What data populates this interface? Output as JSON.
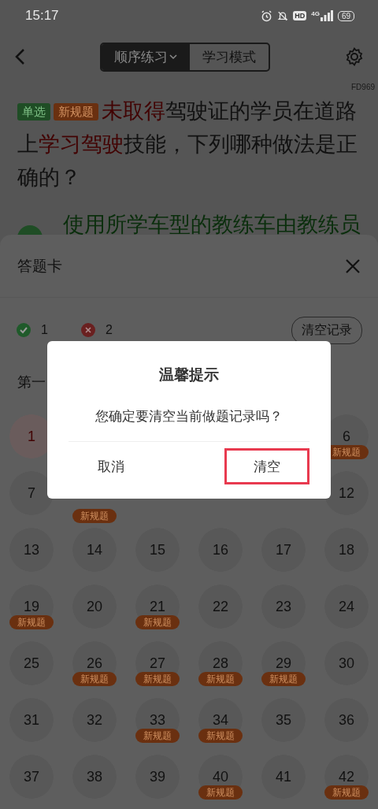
{
  "status_bar": {
    "time": "15:17",
    "hd": "HD",
    "network": "4G",
    "battery": "69"
  },
  "header": {
    "modes": [
      {
        "label": "顺序练习",
        "selected": true,
        "dropdown": true
      },
      {
        "label": "学习模式",
        "selected": false,
        "dropdown": false
      }
    ],
    "code": "FD969"
  },
  "question": {
    "tags": [
      {
        "label": "单选",
        "kind": "type"
      },
      {
        "label": "新规题",
        "kind": "new"
      }
    ],
    "segments": [
      {
        "text": "未取得",
        "highlight": true
      },
      {
        "text": "驾驶证的学员在道路上",
        "highlight": false
      },
      {
        "text": "学习驾驶",
        "highlight": true
      },
      {
        "text": "技能，下列哪种做法是正确的？",
        "highlight": false
      }
    ],
    "option": {
      "text": "使用所学车型的教练车由教练员"
    }
  },
  "answer_card": {
    "title": "答题卡",
    "correct": "1",
    "wrong": "2",
    "clear_button": "清空记录",
    "section": "第一",
    "cells": [
      {
        "kind": "number",
        "number": "1",
        "wrong": true
      },
      {
        "kind": "covered"
      },
      {
        "kind": "covered"
      },
      {
        "kind": "covered"
      },
      {
        "kind": "covered"
      },
      {
        "kind": "number",
        "number": "6",
        "wrong": false,
        "badge": "新规题"
      },
      {
        "kind": "number",
        "number": "7",
        "wrong": false
      },
      {
        "kind": "covered",
        "badge": "新规题"
      },
      {
        "kind": "covered"
      },
      {
        "kind": "covered"
      },
      {
        "kind": "covered"
      },
      {
        "kind": "number",
        "number": "12",
        "wrong": false
      },
      {
        "kind": "number",
        "number": "13",
        "wrong": false
      },
      {
        "kind": "number",
        "number": "14",
        "wrong": false
      },
      {
        "kind": "number",
        "number": "15",
        "wrong": false
      },
      {
        "kind": "number",
        "number": "16",
        "wrong": false
      },
      {
        "kind": "number",
        "number": "17",
        "wrong": false
      },
      {
        "kind": "number",
        "number": "18",
        "wrong": false
      },
      {
        "kind": "number",
        "number": "19",
        "wrong": false,
        "badge": "新规题"
      },
      {
        "kind": "number",
        "number": "20",
        "wrong": false
      },
      {
        "kind": "number",
        "number": "21",
        "wrong": false,
        "badge": "新规题"
      },
      {
        "kind": "number",
        "number": "22",
        "wrong": false
      },
      {
        "kind": "number",
        "number": "23",
        "wrong": false
      },
      {
        "kind": "number",
        "number": "24",
        "wrong": false
      },
      {
        "kind": "number",
        "number": "25",
        "wrong": false
      },
      {
        "kind": "number",
        "number": "26",
        "wrong": false,
        "badge": "新规题"
      },
      {
        "kind": "number",
        "number": "27",
        "wrong": false,
        "badge": "新规题"
      },
      {
        "kind": "number",
        "number": "28",
        "wrong": false,
        "badge": "新规题"
      },
      {
        "kind": "number",
        "number": "29",
        "wrong": false,
        "badge": "新规题"
      },
      {
        "kind": "number",
        "number": "30",
        "wrong": false
      },
      {
        "kind": "number",
        "number": "31",
        "wrong": false
      },
      {
        "kind": "number",
        "number": "32",
        "wrong": false
      },
      {
        "kind": "number",
        "number": "33",
        "wrong": false,
        "badge": "新规题"
      },
      {
        "kind": "number",
        "number": "34",
        "wrong": false,
        "badge": "新规题"
      },
      {
        "kind": "number",
        "number": "35",
        "wrong": false
      },
      {
        "kind": "number",
        "number": "36",
        "wrong": false
      },
      {
        "kind": "number",
        "number": "37",
        "wrong": false
      },
      {
        "kind": "number",
        "number": "38",
        "wrong": false
      },
      {
        "kind": "number",
        "number": "39",
        "wrong": false
      },
      {
        "kind": "number",
        "number": "40",
        "wrong": false,
        "badge": "新规题"
      },
      {
        "kind": "number",
        "number": "41",
        "wrong": false
      },
      {
        "kind": "number",
        "number": "42",
        "wrong": false,
        "badge": "新规题"
      }
    ]
  },
  "dialog": {
    "title": "温馨提示",
    "message": "您确定要清空当前做题记录吗？",
    "buttons": [
      {
        "label": "取消",
        "highlighted": false
      },
      {
        "label": "清空",
        "highlighted": true
      }
    ]
  }
}
